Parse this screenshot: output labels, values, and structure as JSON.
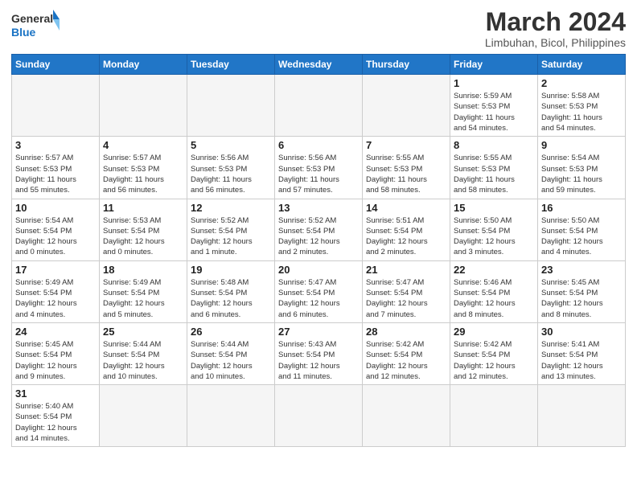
{
  "header": {
    "logo_general": "General",
    "logo_blue": "Blue",
    "month_title": "March 2024",
    "location": "Limbuhan, Bicol, Philippines"
  },
  "weekdays": [
    "Sunday",
    "Monday",
    "Tuesday",
    "Wednesday",
    "Thursday",
    "Friday",
    "Saturday"
  ],
  "weeks": [
    [
      {
        "day": "",
        "info": ""
      },
      {
        "day": "",
        "info": ""
      },
      {
        "day": "",
        "info": ""
      },
      {
        "day": "",
        "info": ""
      },
      {
        "day": "",
        "info": ""
      },
      {
        "day": "1",
        "info": "Sunrise: 5:59 AM\nSunset: 5:53 PM\nDaylight: 11 hours\nand 54 minutes."
      },
      {
        "day": "2",
        "info": "Sunrise: 5:58 AM\nSunset: 5:53 PM\nDaylight: 11 hours\nand 54 minutes."
      }
    ],
    [
      {
        "day": "3",
        "info": "Sunrise: 5:57 AM\nSunset: 5:53 PM\nDaylight: 11 hours\nand 55 minutes."
      },
      {
        "day": "4",
        "info": "Sunrise: 5:57 AM\nSunset: 5:53 PM\nDaylight: 11 hours\nand 56 minutes."
      },
      {
        "day": "5",
        "info": "Sunrise: 5:56 AM\nSunset: 5:53 PM\nDaylight: 11 hours\nand 56 minutes."
      },
      {
        "day": "6",
        "info": "Sunrise: 5:56 AM\nSunset: 5:53 PM\nDaylight: 11 hours\nand 57 minutes."
      },
      {
        "day": "7",
        "info": "Sunrise: 5:55 AM\nSunset: 5:53 PM\nDaylight: 11 hours\nand 58 minutes."
      },
      {
        "day": "8",
        "info": "Sunrise: 5:55 AM\nSunset: 5:53 PM\nDaylight: 11 hours\nand 58 minutes."
      },
      {
        "day": "9",
        "info": "Sunrise: 5:54 AM\nSunset: 5:53 PM\nDaylight: 11 hours\nand 59 minutes."
      }
    ],
    [
      {
        "day": "10",
        "info": "Sunrise: 5:54 AM\nSunset: 5:54 PM\nDaylight: 12 hours\nand 0 minutes."
      },
      {
        "day": "11",
        "info": "Sunrise: 5:53 AM\nSunset: 5:54 PM\nDaylight: 12 hours\nand 0 minutes."
      },
      {
        "day": "12",
        "info": "Sunrise: 5:52 AM\nSunset: 5:54 PM\nDaylight: 12 hours\nand 1 minute."
      },
      {
        "day": "13",
        "info": "Sunrise: 5:52 AM\nSunset: 5:54 PM\nDaylight: 12 hours\nand 2 minutes."
      },
      {
        "day": "14",
        "info": "Sunrise: 5:51 AM\nSunset: 5:54 PM\nDaylight: 12 hours\nand 2 minutes."
      },
      {
        "day": "15",
        "info": "Sunrise: 5:50 AM\nSunset: 5:54 PM\nDaylight: 12 hours\nand 3 minutes."
      },
      {
        "day": "16",
        "info": "Sunrise: 5:50 AM\nSunset: 5:54 PM\nDaylight: 12 hours\nand 4 minutes."
      }
    ],
    [
      {
        "day": "17",
        "info": "Sunrise: 5:49 AM\nSunset: 5:54 PM\nDaylight: 12 hours\nand 4 minutes."
      },
      {
        "day": "18",
        "info": "Sunrise: 5:49 AM\nSunset: 5:54 PM\nDaylight: 12 hours\nand 5 minutes."
      },
      {
        "day": "19",
        "info": "Sunrise: 5:48 AM\nSunset: 5:54 PM\nDaylight: 12 hours\nand 6 minutes."
      },
      {
        "day": "20",
        "info": "Sunrise: 5:47 AM\nSunset: 5:54 PM\nDaylight: 12 hours\nand 6 minutes."
      },
      {
        "day": "21",
        "info": "Sunrise: 5:47 AM\nSunset: 5:54 PM\nDaylight: 12 hours\nand 7 minutes."
      },
      {
        "day": "22",
        "info": "Sunrise: 5:46 AM\nSunset: 5:54 PM\nDaylight: 12 hours\nand 8 minutes."
      },
      {
        "day": "23",
        "info": "Sunrise: 5:45 AM\nSunset: 5:54 PM\nDaylight: 12 hours\nand 8 minutes."
      }
    ],
    [
      {
        "day": "24",
        "info": "Sunrise: 5:45 AM\nSunset: 5:54 PM\nDaylight: 12 hours\nand 9 minutes."
      },
      {
        "day": "25",
        "info": "Sunrise: 5:44 AM\nSunset: 5:54 PM\nDaylight: 12 hours\nand 10 minutes."
      },
      {
        "day": "26",
        "info": "Sunrise: 5:44 AM\nSunset: 5:54 PM\nDaylight: 12 hours\nand 10 minutes."
      },
      {
        "day": "27",
        "info": "Sunrise: 5:43 AM\nSunset: 5:54 PM\nDaylight: 12 hours\nand 11 minutes."
      },
      {
        "day": "28",
        "info": "Sunrise: 5:42 AM\nSunset: 5:54 PM\nDaylight: 12 hours\nand 12 minutes."
      },
      {
        "day": "29",
        "info": "Sunrise: 5:42 AM\nSunset: 5:54 PM\nDaylight: 12 hours\nand 12 minutes."
      },
      {
        "day": "30",
        "info": "Sunrise: 5:41 AM\nSunset: 5:54 PM\nDaylight: 12 hours\nand 13 minutes."
      }
    ],
    [
      {
        "day": "31",
        "info": "Sunrise: 5:40 AM\nSunset: 5:54 PM\nDaylight: 12 hours\nand 14 minutes."
      },
      {
        "day": "",
        "info": ""
      },
      {
        "day": "",
        "info": ""
      },
      {
        "day": "",
        "info": ""
      },
      {
        "day": "",
        "info": ""
      },
      {
        "day": "",
        "info": ""
      },
      {
        "day": "",
        "info": ""
      }
    ]
  ]
}
